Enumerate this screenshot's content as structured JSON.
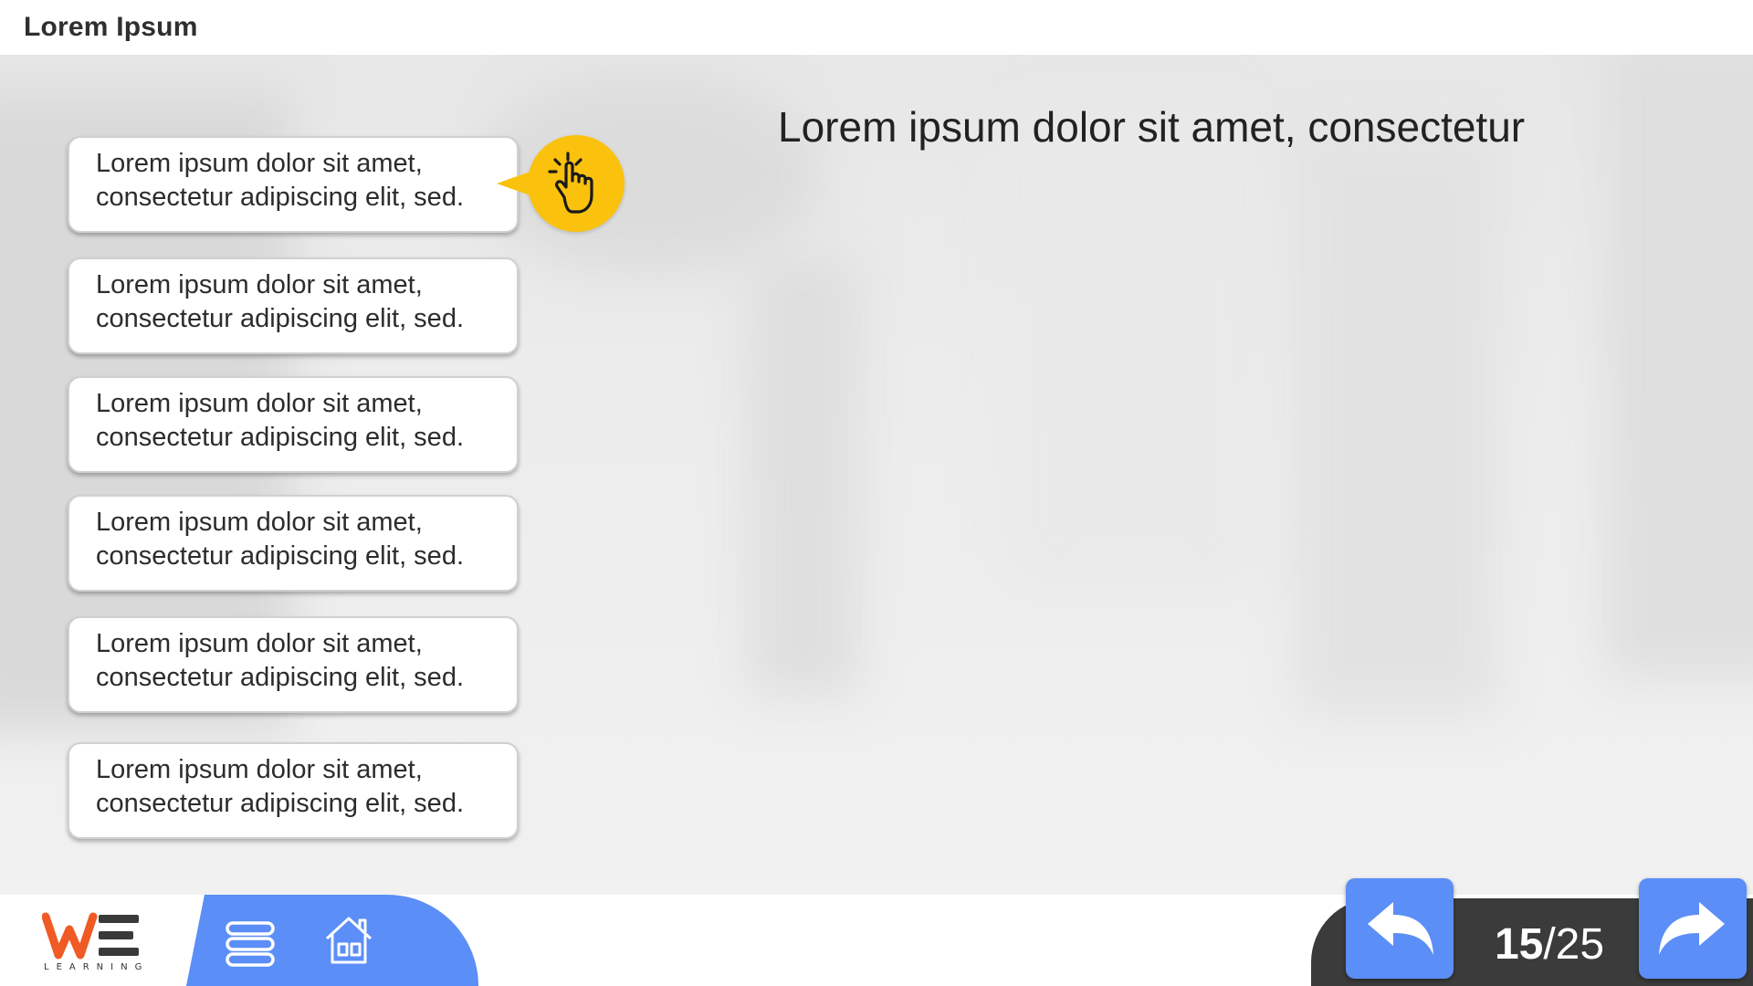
{
  "app": {
    "title": "Lorem Ipsum"
  },
  "slide": {
    "heading": "Lorem ipsum dolor sit amet, consectetur",
    "options": [
      {
        "line1": "Lorem ipsum dolor sit amet,",
        "line2": "consectetur adipiscing elit, sed."
      },
      {
        "line1": "Lorem ipsum dolor sit amet,",
        "line2": "consectetur adipiscing elit, sed."
      },
      {
        "line1": "Lorem ipsum dolor sit amet,",
        "line2": "consectetur adipiscing elit, sed."
      },
      {
        "line1": "Lorem ipsum dolor sit amet,",
        "line2": "consectetur adipiscing elit, sed."
      },
      {
        "line1": "Lorem ipsum dolor sit amet,",
        "line2": "consectetur adipiscing elit, sed."
      },
      {
        "line1": "Lorem ipsum dolor sit amet,",
        "line2": "consectetur adipiscing elit, sed."
      }
    ],
    "hint_icon": "tap-hand-icon"
  },
  "footer": {
    "logo_text": "LEARNING",
    "menu_icon": "menu-icon",
    "home_icon": "home-icon",
    "back_icon": "back-arrow-icon",
    "next_icon": "next-arrow-icon",
    "page_current": "15",
    "page_separator": "/",
    "page_total": "25"
  },
  "colors": {
    "accent_blue": "#5b8ef6",
    "hint_yellow": "#fbc20d",
    "logo_orange": "#f05a24",
    "pager_dark": "#3b3b3b"
  }
}
